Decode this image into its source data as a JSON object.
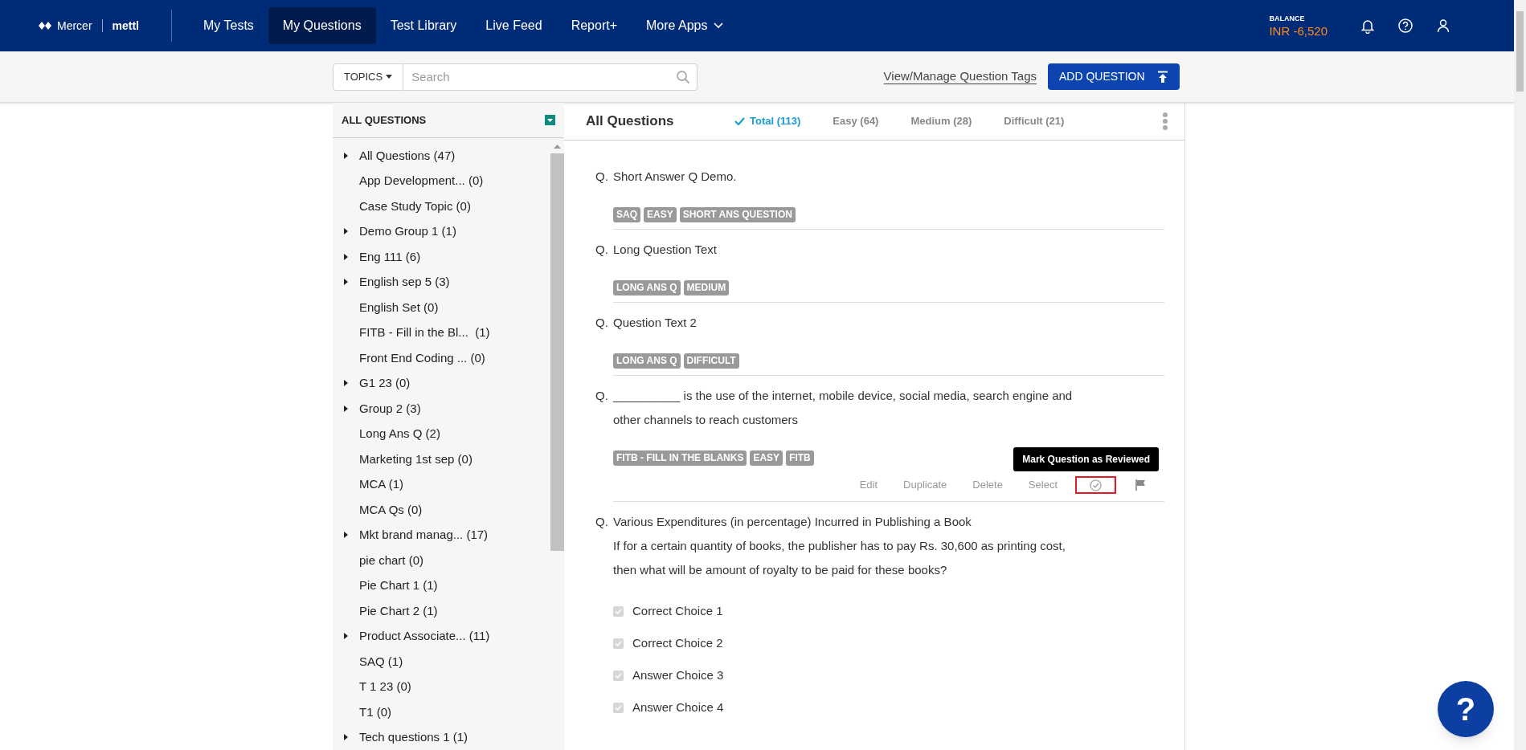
{
  "header": {
    "logo": {
      "brand": "Mercer",
      "product": "mettl"
    },
    "nav": [
      {
        "label": "My Tests",
        "selected": false
      },
      {
        "label": "My Questions",
        "selected": true
      },
      {
        "label": "Test Library",
        "selected": false
      },
      {
        "label": "Live Feed",
        "selected": false
      },
      {
        "label": "Report+",
        "selected": false
      },
      {
        "label": "More Apps",
        "selected": false,
        "dropdown": true
      }
    ],
    "balance": {
      "label": "BALANCE",
      "value": "INR -6,520"
    }
  },
  "toolbar": {
    "topics": "TOPICS",
    "search": {
      "placeholder": "Search"
    },
    "tags_link": "View/Manage Question Tags",
    "add_button": "ADD QUESTION"
  },
  "sidebar": {
    "title": "ALL QUESTIONS",
    "items": [
      {
        "label": "All Questions (47)",
        "expandable": true
      },
      {
        "label": "App Development... (0)",
        "expandable": false
      },
      {
        "label": "Case Study Topic (0)",
        "expandable": false
      },
      {
        "label": "Demo Group 1 (1)",
        "expandable": true
      },
      {
        "label": "Eng 111 (6)",
        "expandable": true
      },
      {
        "label": "English sep 5 (3)",
        "expandable": true
      },
      {
        "label": "English Set (0)",
        "expandable": false
      },
      {
        "label": "FITB - Fill in the Bl...  (1)",
        "expandable": false
      },
      {
        "label": "Front End Coding ... (0)",
        "expandable": false
      },
      {
        "label": "G1 23 (0)",
        "expandable": true
      },
      {
        "label": "Group 2 (3)",
        "expandable": true
      },
      {
        "label": "Long Ans Q (2)",
        "expandable": false
      },
      {
        "label": "Marketing 1st sep (0)",
        "expandable": false
      },
      {
        "label": "MCA (1)",
        "expandable": false
      },
      {
        "label": "MCA Qs (0)",
        "expandable": false
      },
      {
        "label": "Mkt brand manag... (17)",
        "expandable": true
      },
      {
        "label": "pie chart (0)",
        "expandable": false
      },
      {
        "label": "Pie Chart 1 (1)",
        "expandable": false
      },
      {
        "label": "Pie Chart 2 (1)",
        "expandable": false
      },
      {
        "label": "Product Associate... (11)",
        "expandable": true
      },
      {
        "label": "SAQ (1)",
        "expandable": false
      },
      {
        "label": "T 1 23 (0)",
        "expandable": false
      },
      {
        "label": "T1 (0)",
        "expandable": false
      },
      {
        "label": "Tech questions 1 (1)",
        "expandable": true
      }
    ]
  },
  "main": {
    "title": "All Questions",
    "filters": [
      {
        "label": "Total (113)",
        "selected": true
      },
      {
        "label": "Easy (64)",
        "selected": false
      },
      {
        "label": "Medium (28)",
        "selected": false
      },
      {
        "label": "Difficult (21)",
        "selected": false
      }
    ],
    "questions": [
      {
        "prefix": "Q.",
        "lines": [
          "Short Answer Q Demo."
        ],
        "tags": [
          "SAQ",
          "EASY",
          "SHORT ANS QUESTION"
        ]
      },
      {
        "prefix": "Q.",
        "lines": [
          "Long Question Text"
        ],
        "tags": [
          "LONG ANS Q",
          "MEDIUM"
        ]
      },
      {
        "prefix": "Q.",
        "lines": [
          "Question Text 2"
        ],
        "tags": [
          "LONG ANS Q",
          "DIFFICULT"
        ]
      },
      {
        "prefix": "Q.",
        "lines": [
          "__________ is the use of the internet, mobile device, social media, search engine and other channels to reach customers"
        ],
        "tags": [
          "FITB - FILL IN THE BLANKS",
          "EASY",
          "FITB"
        ],
        "actions": {
          "items": [
            "Edit",
            "Duplicate",
            "Delete",
            "Select"
          ],
          "review_highlighted": true,
          "tooltip": "Mark Question as Reviewed"
        }
      },
      {
        "prefix": "Q.",
        "lines": [
          "Various Expenditures (in percentage) Incurred in Publishing a Book",
          "If for a certain quantity of books, the publisher has to pay Rs. 30,600 as printing cost,",
          "then what will be amount of royalty to be paid for these books?"
        ],
        "choices": [
          {
            "label": "Correct Choice 1",
            "checked": true
          },
          {
            "label": "Correct Choice 2",
            "checked": true
          },
          {
            "label": "Answer Choice 3",
            "checked": true
          },
          {
            "label": "Answer Choice 4",
            "checked": true
          }
        ]
      }
    ]
  },
  "help_button": "?"
}
